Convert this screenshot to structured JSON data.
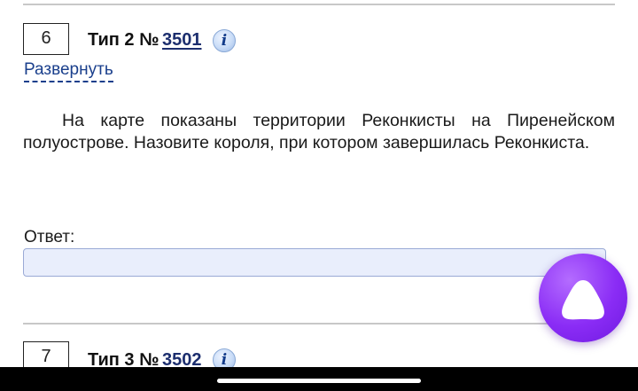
{
  "tasks": [
    {
      "number": "6",
      "type_label": "Тип 2 №",
      "task_id": "3501",
      "info_glyph": "i",
      "expand_label": "Развернуть",
      "question": "На карте показаны территории Реконкисты на Пиренейском полуострове. Назовите короля, при котором завершилась Рекон­киста.",
      "answer_label": "Ответ:",
      "answer_value": ""
    },
    {
      "number": "7",
      "type_label": "Тип 3 №",
      "task_id": "3502",
      "info_glyph": "i"
    }
  ],
  "icons": {
    "info": "info-icon",
    "assistant": "alice-assistant-icon"
  },
  "colors": {
    "link": "#1c2e6e",
    "input_bg": "#e9eefc",
    "assistant": "#8a2cf5"
  }
}
